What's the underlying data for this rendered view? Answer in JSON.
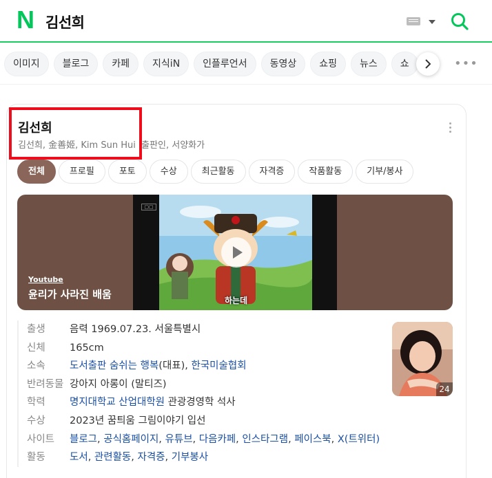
{
  "header": {
    "logo": "N",
    "query": "김선희"
  },
  "nav_chips": [
    "이미지",
    "블로그",
    "카페",
    "지식iN",
    "인플루언서",
    "동영상",
    "쇼핑",
    "뉴스",
    "쇼"
  ],
  "profile": {
    "name": "김선희",
    "aliases": "김선희, 金善姬, Kim Sun Hui",
    "occupations": "출판인, 서양화가",
    "photo_count": "24"
  },
  "tabs": [
    "전체",
    "프로필",
    "포토",
    "수상",
    "최근활동",
    "자격증",
    "작품활동",
    "기부/봉사"
  ],
  "video": {
    "source": "Youtube",
    "title": "윤리가 사라진 배움",
    "caption": "하는데"
  },
  "info": {
    "birth": {
      "key": "출생",
      "value": "음력 1969.07.23. 서울특별시"
    },
    "body": {
      "key": "신체",
      "value": "165cm"
    },
    "affiliation": {
      "key": "소속",
      "link1": "도서출판 숨쉬는 행복",
      "suffix1": "(대표), ",
      "link2": "한국미술협회"
    },
    "pet": {
      "key": "반려동물",
      "value": "강아지 아롱이 (말티즈)"
    },
    "education": {
      "key": "학력",
      "link": "명지대학교 산업대학원",
      "suffix": " 관광경영학 석사"
    },
    "award": {
      "key": "수상",
      "value": "2023년 꿈틔움 그림이야기 입선"
    },
    "sites": {
      "key": "사이트",
      "links": [
        "블로그",
        "공식홈페이지",
        "유튜브",
        "다음카페",
        "인스타그램",
        "페이스북",
        "X(트위터)"
      ]
    },
    "activity": {
      "key": "활동",
      "links": [
        "도서",
        "관련활동",
        "자격증",
        "기부봉사"
      ]
    }
  },
  "colors": {
    "brand_green": "#03c75a",
    "highlight_red": "#ee0d1c",
    "active_tab": "#8a6559",
    "link_blue": "#1a4fa5"
  }
}
